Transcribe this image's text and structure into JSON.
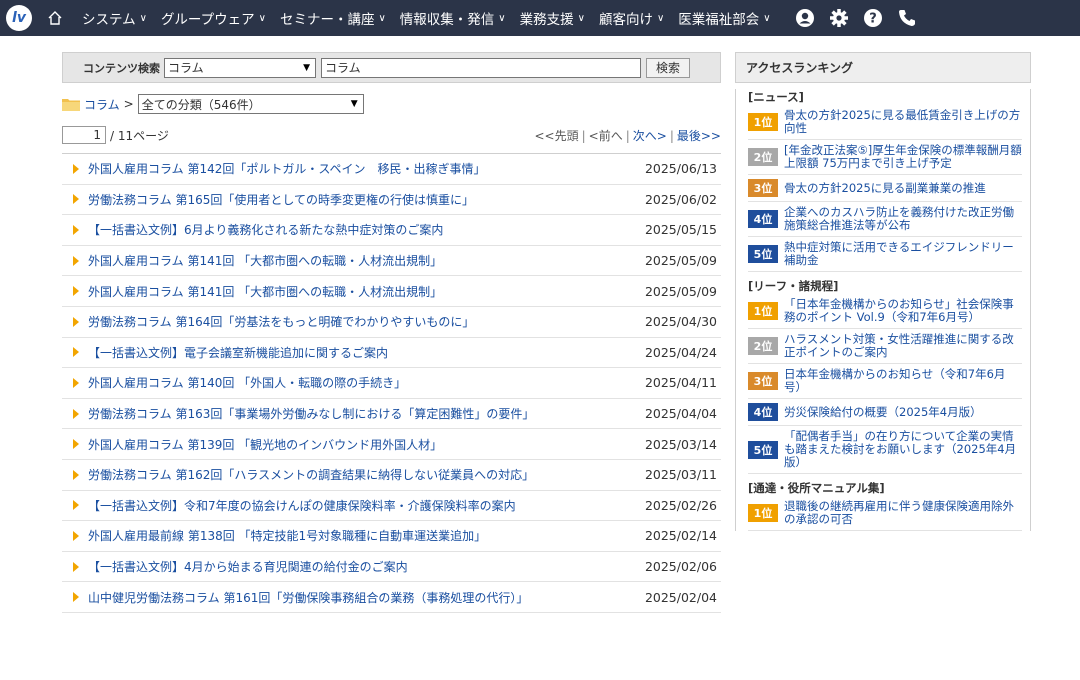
{
  "nav": {
    "logo_text": "lv",
    "items": [
      {
        "label": "システム"
      },
      {
        "label": "グループウェア"
      },
      {
        "label": "セミナー・講座"
      },
      {
        "label": "情報収集・発信"
      },
      {
        "label": "業務支援"
      },
      {
        "label": "顧客向け"
      },
      {
        "label": "医業福祉部会"
      }
    ],
    "icons": [
      "user-icon",
      "gear-icon",
      "help-icon",
      "phone-icon"
    ]
  },
  "search": {
    "label": "コンテンツ検索",
    "select_value": "コラム",
    "input_value": "コラム",
    "button_label": "検索"
  },
  "breadcrumb": {
    "root": "コラム",
    "separator": ">",
    "category_select": "全ての分類（546件）"
  },
  "pager": {
    "current_page": "1",
    "total": "/ 11ページ",
    "first": "<<先頭",
    "prev": "<前へ",
    "next": "次へ>",
    "last": "最後>>",
    "bar": "|"
  },
  "articles": [
    {
      "title": "外国人雇用コラム 第142回「ポルトガル・スペイン　移民・出稼ぎ事情」",
      "date": "2025/06/13"
    },
    {
      "title": "労働法務コラム 第165回「使用者としての時季変更権の行使は慎重に」",
      "date": "2025/06/02"
    },
    {
      "title": "【一括書込文例】6月より義務化される新たな熱中症対策のご案内",
      "date": "2025/05/15"
    },
    {
      "title": "外国人雇用コラム 第141回 「大都市圏への転職・人材流出規制」",
      "date": "2025/05/09"
    },
    {
      "title": "外国人雇用コラム 第141回 「大都市圏への転職・人材流出規制」",
      "date": "2025/05/09"
    },
    {
      "title": "労働法務コラム 第164回「労基法をもっと明確でわかりやすいものに」",
      "date": "2025/04/30"
    },
    {
      "title": "【一括書込文例】電子会議室新機能追加に関するご案内",
      "date": "2025/04/24"
    },
    {
      "title": "外国人雇用コラム 第140回 「外国人・転職の際の手続き」",
      "date": "2025/04/11"
    },
    {
      "title": "労働法務コラム 第163回「事業場外労働みなし制における「算定困難性」の要件」",
      "date": "2025/04/04"
    },
    {
      "title": "外国人雇用コラム 第139回 「観光地のインバウンド用外国人材」",
      "date": "2025/03/14"
    },
    {
      "title": "労働法務コラム 第162回「ハラスメントの調査結果に納得しない従業員への対応」",
      "date": "2025/03/11"
    },
    {
      "title": "【一括書込文例】令和7年度の協会けんぽの健康保険料率・介護保険料率の案内",
      "date": "2025/02/26"
    },
    {
      "title": "外国人雇用最前線 第138回 「特定技能1号対象職種に自動車運送業追加」",
      "date": "2025/02/14"
    },
    {
      "title": "【一括書込文例】4月から始まる育児関連の給付金のご案内",
      "date": "2025/02/06"
    },
    {
      "title": "山中健児労働法務コラム 第161回「労働保険事務組合の業務（事務処理の代行）」",
      "date": "2025/02/04"
    }
  ],
  "ranking": {
    "title": "アクセスランキング",
    "colors": {
      "gold": "#f0a000",
      "silver": "#a8a8a8",
      "bronze": "#d98a2b",
      "blue": "#1f4e9c"
    },
    "groups": [
      {
        "name": "[ニュース]",
        "items": [
          {
            "rank": "1位",
            "text": "骨太の方針2025に見る最低賃金引き上げの方向性"
          },
          {
            "rank": "2位",
            "text": "[年金改正法案⑤]厚生年金保険の標準報酬月額上限額 75万円まで引き上げ予定"
          },
          {
            "rank": "3位",
            "text": "骨太の方針2025に見る副業兼業の推進"
          },
          {
            "rank": "4位",
            "text": "企業へのカスハラ防止を義務付けた改正労働施策総合推進法等が公布"
          },
          {
            "rank": "5位",
            "text": "熱中症対策に活用できるエイジフレンドリー補助金"
          }
        ]
      },
      {
        "name": "[リーフ・諸規程]",
        "items": [
          {
            "rank": "1位",
            "text": "「日本年金機構からのお知らせ」社会保険事務のポイント Vol.9（令和7年6月号）"
          },
          {
            "rank": "2位",
            "text": "ハラスメント対策・女性活躍推進に関する改正ポイントのご案内"
          },
          {
            "rank": "3位",
            "text": "日本年金機構からのお知らせ（令和7年6月号）"
          },
          {
            "rank": "4位",
            "text": "労災保険給付の概要（2025年4月版）"
          },
          {
            "rank": "5位",
            "text": "「配偶者手当」の在り方について企業の実情も踏まえた検討をお願いします（2025年4月版）"
          }
        ]
      },
      {
        "name": "[通達・役所マニュアル集]",
        "items": [
          {
            "rank": "1位",
            "text": "退職後の継続再雇用に伴う健康保険適用除外の承認の可否"
          }
        ]
      }
    ]
  }
}
